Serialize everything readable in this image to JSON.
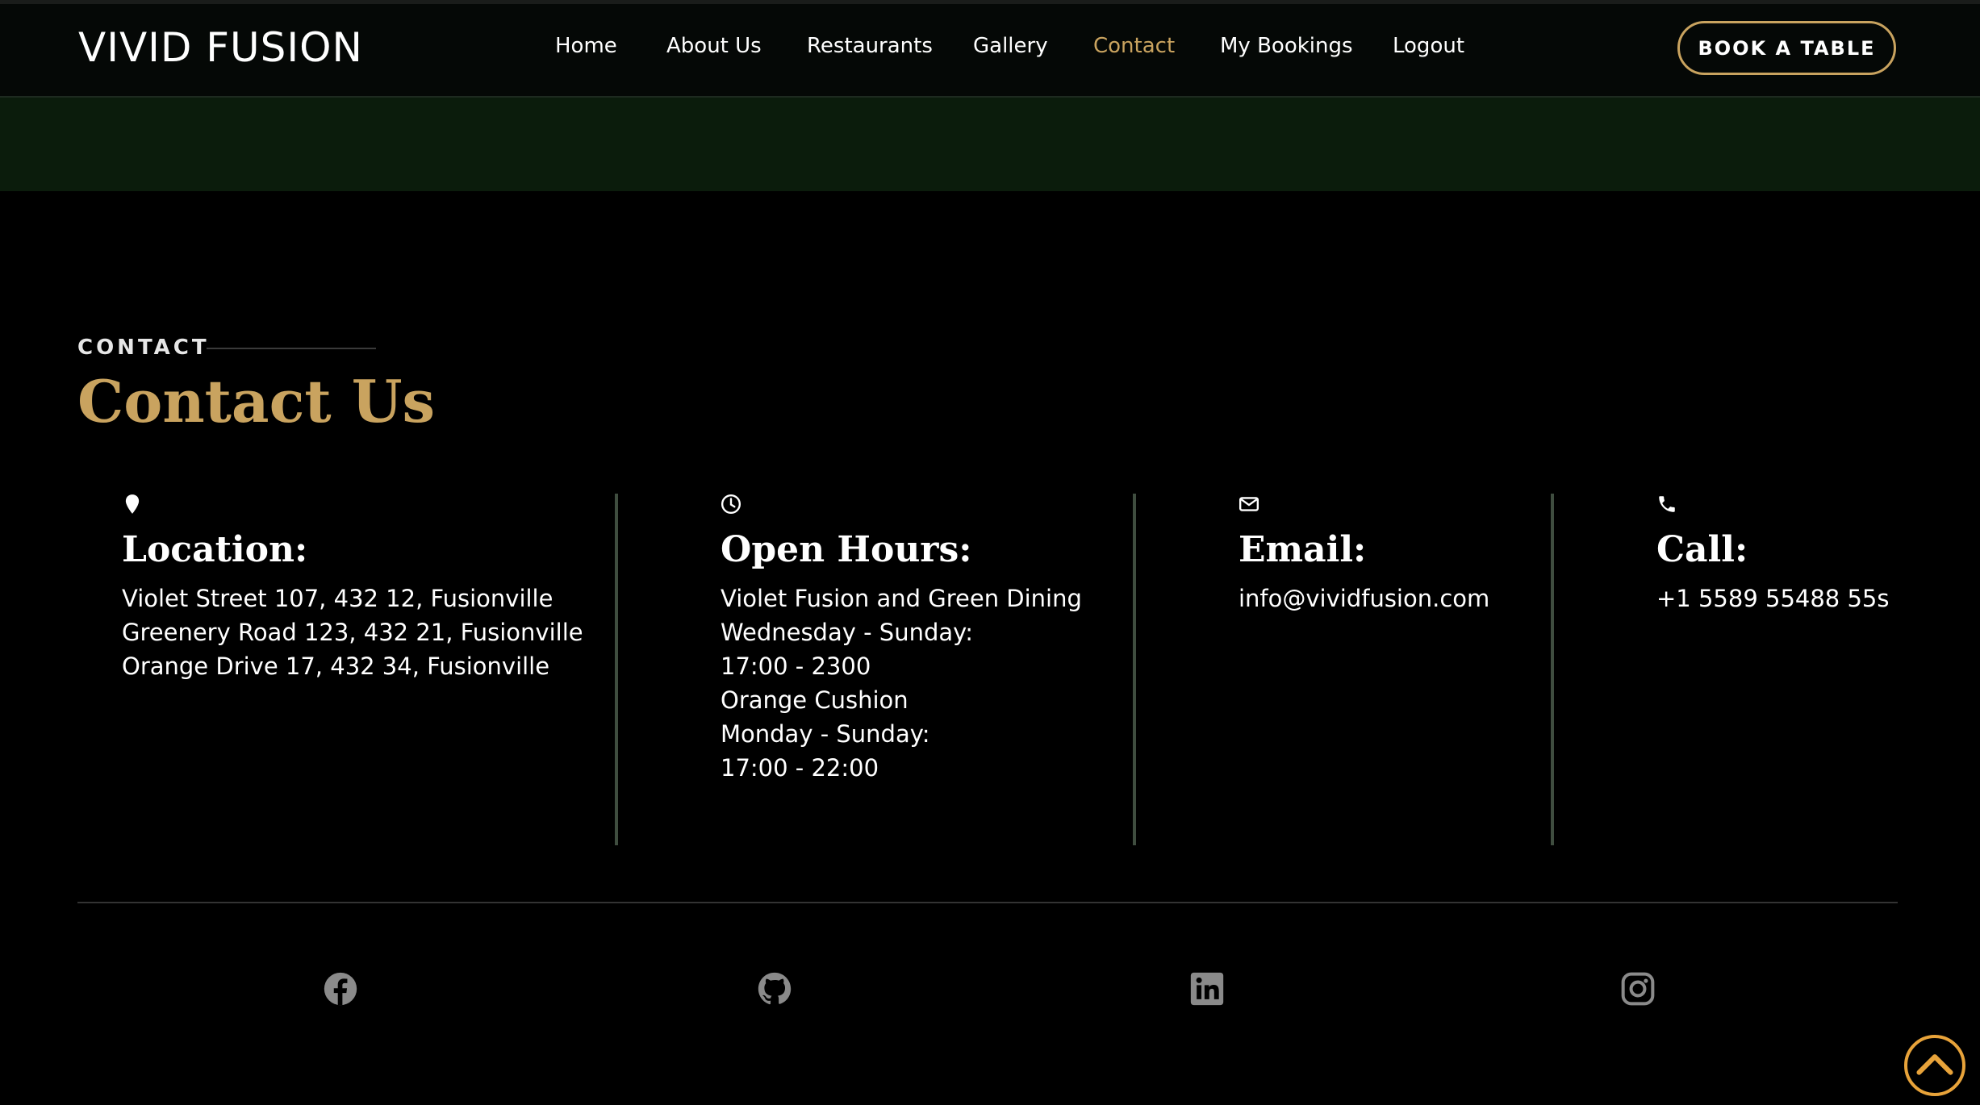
{
  "header": {
    "brand": "VIVID FUSION",
    "nav": [
      {
        "label": "Home",
        "active": false
      },
      {
        "label": "About Us",
        "active": false
      },
      {
        "label": "Restaurants",
        "active": false
      },
      {
        "label": "Gallery",
        "active": false
      },
      {
        "label": "Contact",
        "active": true
      },
      {
        "label": "My Bookings",
        "active": false
      },
      {
        "label": "Logout",
        "active": false
      }
    ],
    "book_button": "BOOK A TABLE"
  },
  "contact": {
    "section_label": "CONTACT",
    "title": "Contact Us",
    "location": {
      "icon": "map-pin-icon",
      "heading": "Location:",
      "lines": [
        "Violet Street 107, 432 12, Fusionville",
        "Greenery Road 123, 432 21, Fusionville",
        "Orange Drive 17, 432 34, Fusionville"
      ]
    },
    "hours": {
      "icon": "clock-icon",
      "heading": "Open Hours:",
      "lines": [
        "Violet Fusion and Green Dining",
        "Wednesday - Sunday:",
        "17:00 - 2300",
        "Orange Cushion",
        "Monday - Sunday:",
        "17:00 - 22:00"
      ]
    },
    "email": {
      "icon": "envelope-icon",
      "heading": "Email:",
      "value": "info@vividfusion.com"
    },
    "call": {
      "icon": "phone-icon",
      "heading": "Call:",
      "value": "+1 5589 55488 55s"
    }
  },
  "footer": {
    "social": [
      "facebook-icon",
      "github-icon",
      "linkedin-icon",
      "instagram-icon"
    ]
  },
  "colors": {
    "accent": "#c9a35f",
    "scroll_top": "#e8a33a",
    "band": "#0b1c0c"
  }
}
